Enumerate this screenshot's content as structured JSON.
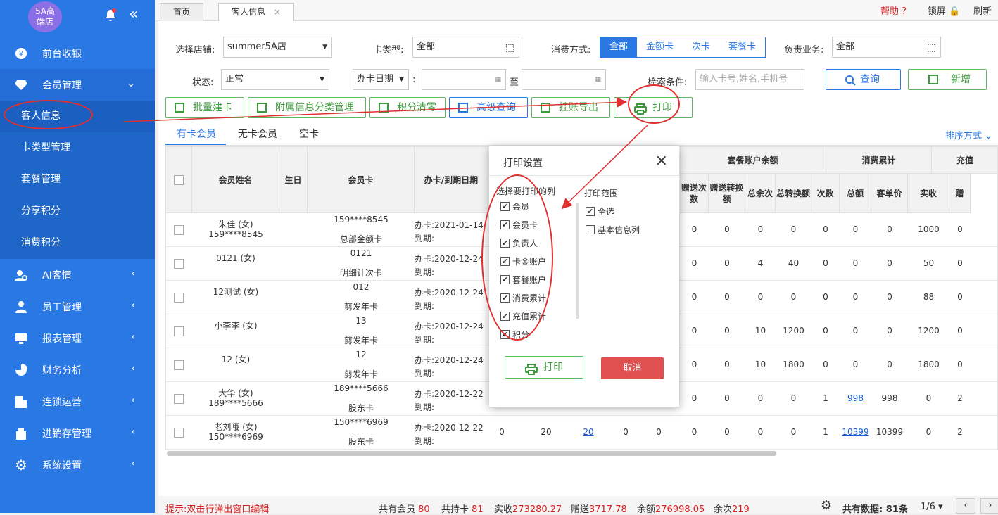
{
  "store_logo": "5A高\n端店",
  "sidebar": {
    "items": [
      {
        "label": "前台收银",
        "icon": "cash-icon"
      },
      {
        "label": "会员管理",
        "icon": "diamond-icon"
      },
      {
        "label": "AI客情",
        "icon": "ai-user-icon"
      },
      {
        "label": "员工管理",
        "icon": "staff-icon"
      },
      {
        "label": "报表管理",
        "icon": "report-icon"
      },
      {
        "label": "财务分析",
        "icon": "pie-icon"
      },
      {
        "label": "连锁运营",
        "icon": "building-icon"
      },
      {
        "label": "进销存管理",
        "icon": "inventory-icon"
      },
      {
        "label": "系统设置",
        "icon": "gear-icon"
      }
    ],
    "sub_items": [
      "客人信息",
      "卡类型管理",
      "套餐管理",
      "分享积分",
      "消费积分"
    ]
  },
  "tabs": [
    {
      "label": "首页"
    },
    {
      "label": "客人信息",
      "close": "×"
    }
  ],
  "topright": {
    "help": "帮助",
    "lock": "锁屏",
    "refresh": "刷新"
  },
  "filters": {
    "store_label": "选择店铺:",
    "store_value": "summer5A店",
    "cardtype_label": "卡类型:",
    "cardtype_value": "全部",
    "consume_label": "消费方式:",
    "consume_options": [
      "全部",
      "金额卡",
      "次卡",
      "套餐卡"
    ],
    "owner_label": "负责业务:",
    "owner_value": "全部",
    "status_label": "状态:",
    "status_value": "正常",
    "date_select": "办卡日期",
    "to": "至",
    "search_label": "检索条件:",
    "search_placeholder": "输入卡号,姓名,手机号",
    "query": "查询",
    "add": "新增",
    "colon": ":"
  },
  "actions": [
    "批量建卡",
    "附属信息分类管理",
    "积分清零",
    "高级查询",
    "挂账导出",
    "打印"
  ],
  "member_tabs": [
    "有卡会员",
    "无卡会员",
    "空卡"
  ],
  "sort": "排序方式",
  "table": {
    "headers": {
      "name": "会员姓名",
      "birthday": "生日",
      "card": "会员卡",
      "date": "办卡/到期日期",
      "pkg_balance": "套餐账户余额",
      "consume": "消费累计",
      "recharge": "充值"
    },
    "sub_headers": [
      "赠送次数",
      "赠送转换额",
      "总余次",
      "总转换额",
      "次数",
      "总额",
      "客单价",
      "实收",
      "赠"
    ],
    "date_prefix_open": "办卡:",
    "date_prefix_exp": "到期:",
    "rows": [
      {
        "name": "朱佳 (女)",
        "phone": "159****8545",
        "card_no": "159****8545",
        "card_type": "总部金额卡",
        "open": "2021-01-14",
        "v": [
          "0",
          "0",
          "0",
          "0",
          "0",
          "0",
          "0",
          "1000",
          "0"
        ]
      },
      {
        "name": "0121 (女)",
        "phone": "",
        "card_no": "0121",
        "card_type": "明细计次卡",
        "open": "2020-12-24",
        "v": [
          "0",
          "0",
          "4",
          "40",
          "0",
          "0",
          "0",
          "50",
          "0"
        ]
      },
      {
        "name": "12测试 (女)",
        "phone": "",
        "card_no": "012",
        "card_type": "剪发年卡",
        "open": "2020-12-24",
        "v": [
          "0",
          "0",
          "0",
          "0",
          "0",
          "0",
          "0",
          "88",
          "0"
        ]
      },
      {
        "name": "小李李 (女)",
        "phone": "",
        "card_no": "13",
        "card_type": "剪发年卡",
        "open": "2020-12-24",
        "v": [
          "0",
          "0",
          "10",
          "1200",
          "0",
          "0",
          "0",
          "1200",
          "0"
        ]
      },
      {
        "name": "12 (女)",
        "phone": "",
        "card_no": "12",
        "card_type": "剪发年卡",
        "open": "2020-12-24",
        "v": [
          "0",
          "0",
          "10",
          "1800",
          "0",
          "0",
          "0",
          "1800",
          "0"
        ]
      },
      {
        "name": "大华 (女)",
        "phone": "189****5666",
        "card_no": "189****5666",
        "card_type": "股东卡",
        "open": "2020-12-22",
        "v": [
          "0",
          "0",
          "0",
          "0",
          "1",
          "998",
          "998",
          "0",
          "2"
        ]
      },
      {
        "name": "老刘哦 (女)",
        "phone": "150****6969",
        "card_no": "150****6969",
        "card_type": "股东卡",
        "open": "2020-12-22",
        "v": [
          "0",
          "0",
          "0",
          "0",
          "1",
          "10399",
          "10399",
          "0",
          "2"
        ],
        "extra": [
          "0",
          "20",
          "20",
          "0",
          "0"
        ]
      }
    ]
  },
  "modal": {
    "title": "打印设置",
    "cols_label": "选择要打印的列",
    "columns": [
      "会员",
      "会员卡",
      "负责人",
      "卡金账户",
      "套餐账户",
      "消费累计",
      "充值累计",
      "积分"
    ],
    "range_label": "打印范围",
    "range": [
      {
        "label": "全选",
        "checked": true
      },
      {
        "label": "基本信息列",
        "checked": false
      }
    ],
    "print": "打印",
    "cancel": "取消",
    "close": "×"
  },
  "footer": {
    "tip": "提示:双击行弹出窗口编辑",
    "members_label": "共有会员",
    "members": "80",
    "cards_label": "共持卡",
    "cards": "81",
    "paid_label": "实收",
    "paid": "273280.27",
    "gift_label": "赠送",
    "gift": "3717.78",
    "balance_label": "余额",
    "balance": "276998.05",
    "times_label": "余次",
    "times": "219",
    "total": "共有数据: 81条",
    "page": "1/6"
  }
}
